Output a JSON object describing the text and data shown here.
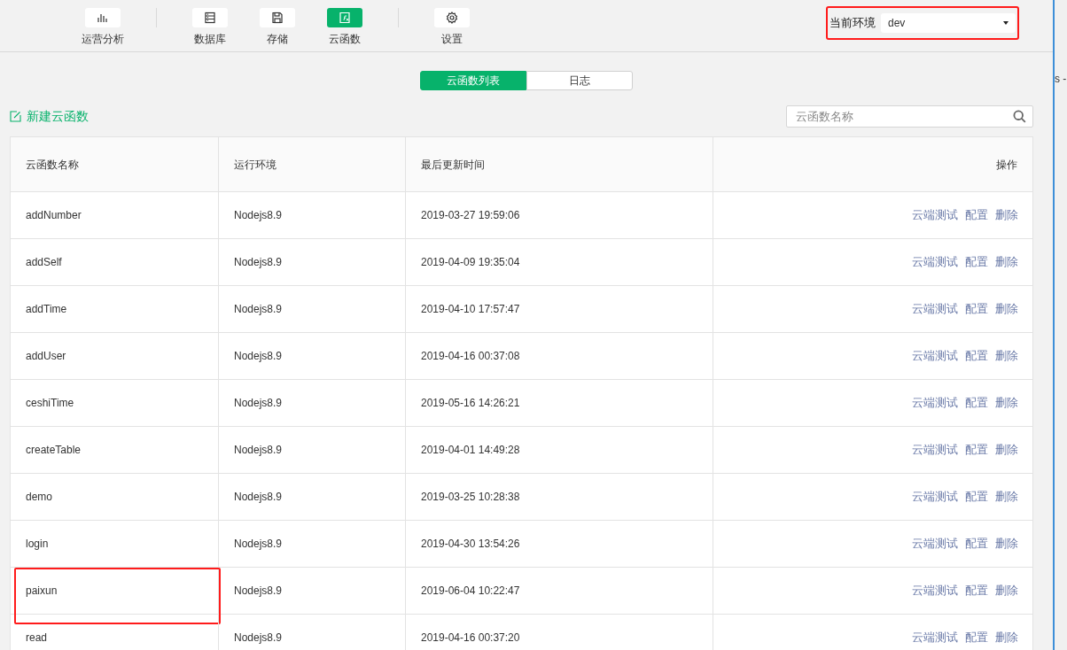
{
  "toolbar": {
    "groups": [
      {
        "items": [
          {
            "kind": "chart",
            "label": "运营分析",
            "selected": false
          }
        ]
      },
      {
        "items": [
          {
            "kind": "database",
            "label": "数据库",
            "selected": false
          },
          {
            "kind": "storage",
            "label": "存储",
            "selected": false
          },
          {
            "kind": "function",
            "label": "云函数",
            "selected": true
          }
        ]
      },
      {
        "items": [
          {
            "kind": "settings",
            "label": "设置",
            "selected": false
          }
        ]
      }
    ]
  },
  "environment": {
    "label": "当前环境",
    "value": "dev",
    "highlighted": true
  },
  "tabs": [
    {
      "label": "云函数列表",
      "selected": true
    },
    {
      "label": "日志",
      "selected": false
    }
  ],
  "new_function": {
    "label": "新建云函数"
  },
  "search": {
    "placeholder": "云函数名称"
  },
  "table": {
    "columns": [
      "云函数名称",
      "运行环境",
      "最后更新时间",
      "操作"
    ],
    "rows": [
      {
        "name": "addNumber",
        "runtime": "Nodejs8.9",
        "updated": "2019-03-27 19:59:06",
        "actions": [
          "云端测试",
          "配置",
          "删除"
        ],
        "highlighted": false
      },
      {
        "name": "addSelf",
        "runtime": "Nodejs8.9",
        "updated": "2019-04-09 19:35:04",
        "actions": [
          "云端测试",
          "配置",
          "删除"
        ],
        "highlighted": false
      },
      {
        "name": "addTime",
        "runtime": "Nodejs8.9",
        "updated": "2019-04-10 17:57:47",
        "actions": [
          "云端测试",
          "配置",
          "删除"
        ],
        "highlighted": false
      },
      {
        "name": "addUser",
        "runtime": "Nodejs8.9",
        "updated": "2019-04-16 00:37:08",
        "actions": [
          "云端测试",
          "配置",
          "删除"
        ],
        "highlighted": false
      },
      {
        "name": "ceshiTime",
        "runtime": "Nodejs8.9",
        "updated": "2019-05-16 14:26:21",
        "actions": [
          "云端测试",
          "配置",
          "删除"
        ],
        "highlighted": false
      },
      {
        "name": "createTable",
        "runtime": "Nodejs8.9",
        "updated": "2019-04-01 14:49:28",
        "actions": [
          "云端测试",
          "配置",
          "删除"
        ],
        "highlighted": false
      },
      {
        "name": "demo",
        "runtime": "Nodejs8.9",
        "updated": "2019-03-25 10:28:38",
        "actions": [
          "云端测试",
          "配置",
          "删除"
        ],
        "highlighted": false
      },
      {
        "name": "login",
        "runtime": "Nodejs8.9",
        "updated": "2019-04-30 13:54:26",
        "actions": [
          "云端测试",
          "配置",
          "删除"
        ],
        "highlighted": false
      },
      {
        "name": "paixun",
        "runtime": "Nodejs8.9",
        "updated": "2019-06-04 10:22:47",
        "actions": [
          "云端测试",
          "配置",
          "删除"
        ],
        "highlighted": true
      },
      {
        "name": "read",
        "runtime": "Nodejs8.9",
        "updated": "2019-04-16 00:37:20",
        "actions": [
          "云端测试",
          "配置",
          "删除"
        ],
        "highlighted": false
      }
    ]
  },
  "background_window": {
    "text": "s -"
  }
}
